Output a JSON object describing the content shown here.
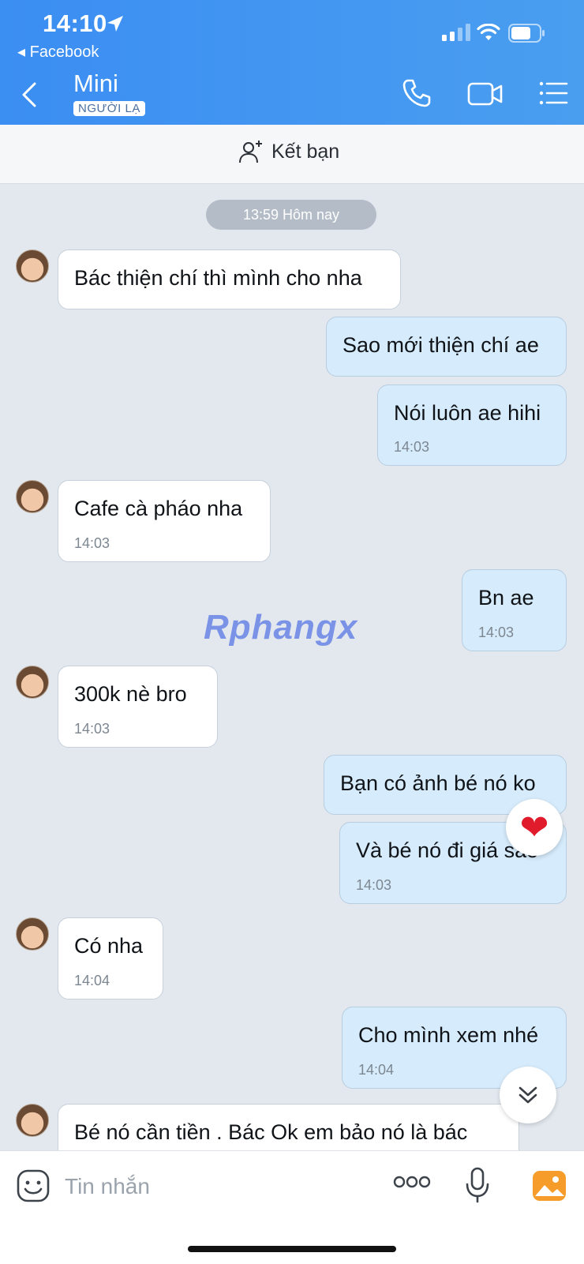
{
  "status_bar": {
    "time": "14:10",
    "back_app": "◂ Facebook"
  },
  "header": {
    "contact_name": "Mini",
    "badge": "NGƯỜI LẠ"
  },
  "add_friend": {
    "label": "Kết bạn"
  },
  "day_separator": "13:59 Hôm nay",
  "watermark": "Rphangx",
  "messages": [
    {
      "dir": "in",
      "text": "Bác thiện chí thì mình cho nha",
      "time": ""
    },
    {
      "dir": "out",
      "text": "Sao mới thiện chí ae",
      "time": ""
    },
    {
      "dir": "out",
      "text": "Nói luôn ae hihi",
      "time": "14:03"
    },
    {
      "dir": "in",
      "text": "Cafe cà pháo nha",
      "time": "14:03"
    },
    {
      "dir": "out",
      "text": "Bn ae",
      "time": "14:03"
    },
    {
      "dir": "in",
      "text": "300k nè bro",
      "time": "14:03"
    },
    {
      "dir": "out",
      "text": "Bạn có ảnh bé nó ko",
      "time": ""
    },
    {
      "dir": "out",
      "text": "Và bé nó đi giá sao",
      "time": "14:03"
    },
    {
      "dir": "in",
      "text": "Có nha",
      "time": "14:04"
    },
    {
      "dir": "out",
      "text": "Cho mình xem nhé",
      "time": "14:04"
    },
    {
      "dir": "in",
      "text": "Bé nó cần tiền . Bác Ok em bảo nó là bác",
      "time": ""
    }
  ],
  "reaction": "❤",
  "composer": {
    "placeholder": "Tin nhắn"
  },
  "icons": [
    "location-arrow-icon",
    "signal-icon",
    "wifi-icon",
    "battery-icon",
    "back-icon",
    "phone-icon",
    "video-icon",
    "menu-icon",
    "add-person-icon",
    "chevron-double-down-icon",
    "emoji-icon",
    "more-icon",
    "mic-icon",
    "photo-icon"
  ],
  "colors": {
    "header": "#4096f2",
    "outgoing_bubble": "#d6ebfb",
    "incoming_bubble": "#ffffff",
    "chat_bg": "#e3e8ef"
  }
}
